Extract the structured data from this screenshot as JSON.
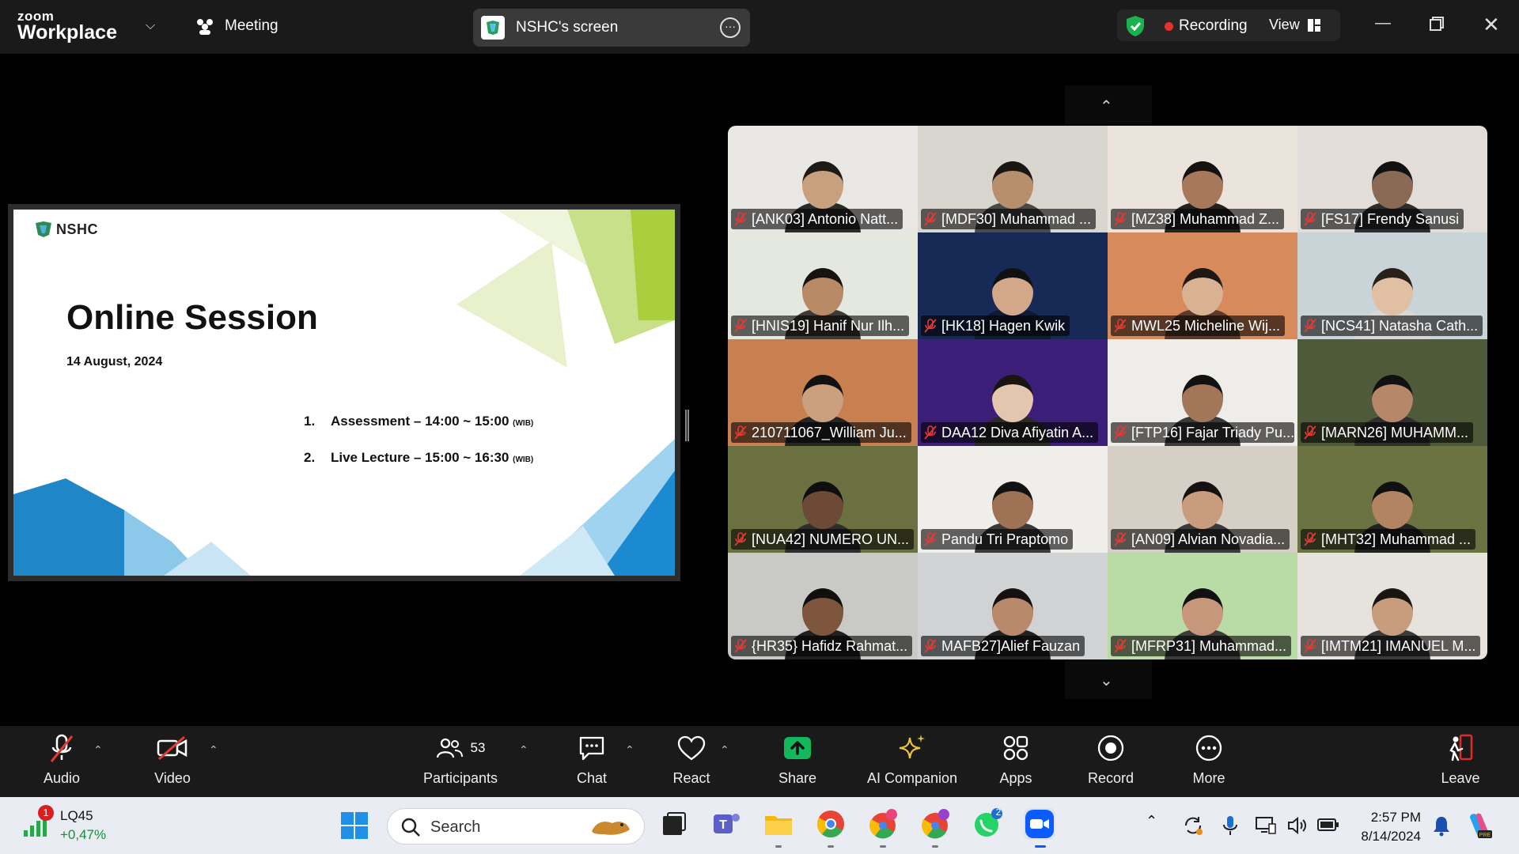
{
  "app": {
    "brand_top": "zoom",
    "brand_bottom": "Workplace"
  },
  "topbar": {
    "meeting_label": "Meeting",
    "share_title": "NSHC's screen",
    "recording_label": "Recording",
    "view_label": "View"
  },
  "slide": {
    "logo_text": "NSHC",
    "title": "Online Session",
    "date": "14 August, 2024",
    "agenda": [
      {
        "num": "1.",
        "text": "Assessment – 14:00 ~ 15:00",
        "suffix": "(WIB)"
      },
      {
        "num": "2.",
        "text": "Live Lecture – 15:00 ~ 16:30",
        "suffix": "(WIB)"
      }
    ]
  },
  "participants": [
    {
      "name": "[ANK03] Antonio Natt...",
      "bg": "#e9e7e3",
      "skin": "#c9a07e",
      "shirt": "#2b2b2b",
      "hair": "#1e1a17"
    },
    {
      "name": "[MDF30] Muhammad ...",
      "bg": "#d9d6cf",
      "skin": "#b88f6c",
      "shirt": "#4a4a4a",
      "hair": "#1a1613"
    },
    {
      "name": "[MZ38] Muhammad Z...",
      "bg": "#eae4dc",
      "skin": "#a8785a",
      "shirt": "#222222",
      "hair": "#141110"
    },
    {
      "name": "[FS17] Frendy Sanusi",
      "bg": "#e2ddd8",
      "skin": "#8a6a55",
      "shirt": "#2d2d2d",
      "hair": "#111111"
    },
    {
      "name": "[HNIS19] Hanif Nur Ilh...",
      "bg": "#e5e8df",
      "skin": "#b88a66",
      "shirt": "#3e3a36",
      "hair": "#161311"
    },
    {
      "name": "[HK18] Hagen Kwik",
      "bg": "#162a55",
      "skin": "#d3a88a",
      "shirt": "#0f1a33",
      "hair": "#111111"
    },
    {
      "name": "MWL25 Micheline Wij...",
      "bg": "#d78a5c",
      "skin": "#d8b292",
      "shirt": "#5a3b2a",
      "hair": "#1f1813"
    },
    {
      "name": "[NCS41] Natasha Cath...",
      "bg": "#c9d4d9",
      "skin": "#e0bfa3",
      "shirt": "#d8d8d8",
      "hair": "#2a201a"
    },
    {
      "name": "210711067_William Ju...",
      "bg": "#c98050",
      "skin": "#caa07f",
      "shirt": "#252525",
      "hair": "#111111"
    },
    {
      "name": "DAA12 Diva Afiyatin A...",
      "bg": "#3b1f78",
      "skin": "#e4c6ae",
      "shirt": "#2a2a2a",
      "hair": "#1a1410"
    },
    {
      "name": "[FTP16] Fajar Triady Pu...",
      "bg": "#efedea",
      "skin": "#a27658",
      "shirt": "#3a3a3a",
      "hair": "#111111"
    },
    {
      "name": "[MARN26] MUHAMM...",
      "bg": "#4f5a3a",
      "skin": "#b7876a",
      "shirt": "#2f2f2f",
      "hair": "#111111"
    },
    {
      "name": "[NUA42] NUMERO UN...",
      "bg": "#6b7040",
      "skin": "#6d4a35",
      "shirt": "#2e2e2e",
      "hair": "#0f0f0f"
    },
    {
      "name": "Pandu Tri Praptomo",
      "bg": "#f0eeea",
      "skin": "#9e7255",
      "shirt": "#3a3a3a",
      "hair": "#111111"
    },
    {
      "name": "[AN09] Alvian Novadia...",
      "bg": "#d6cfc6",
      "skin": "#c89c7c",
      "shirt": "#3a3a3a",
      "hair": "#141110"
    },
    {
      "name": "[MHT32] Muhammad ...",
      "bg": "#6c7343",
      "skin": "#b28462",
      "shirt": "#222222",
      "hair": "#111111"
    },
    {
      "name": "{HR35} Hafidz Rahmat...",
      "bg": "#c9cac5",
      "skin": "#7d563d",
      "shirt": "#1f1f1f",
      "hair": "#0f0f0f"
    },
    {
      "name": "MAFB27]Alief Fauzan",
      "bg": "#d0d2d4",
      "skin": "#b8896a",
      "shirt": "#222222",
      "hair": "#141110"
    },
    {
      "name": "[MFRP31] Muhammad...",
      "bg": "#b9dca6",
      "skin": "#c6977a",
      "shirt": "#3b3b3b",
      "hair": "#111111"
    },
    {
      "name": "[IMTM21] IMANUEL M...",
      "bg": "#e6e3dc",
      "skin": "#c79d7e",
      "shirt": "#3a3a3a",
      "hair": "#1a1511"
    }
  ],
  "toolbar": {
    "audio": "Audio",
    "video": "Video",
    "participants": "Participants",
    "participants_count": "53",
    "chat": "Chat",
    "react": "React",
    "share": "Share",
    "ai_companion": "AI Companion",
    "apps": "Apps",
    "record": "Record",
    "more": "More",
    "leave": "Leave"
  },
  "taskbar": {
    "stock_name": "LQ45",
    "stock_change": "+0,47%",
    "widget_badge": "1",
    "search_placeholder": "Search",
    "whatsapp_badge": "2",
    "time": "2:57 PM",
    "date": "8/14/2024"
  },
  "colors": {
    "accent_green": "#18b34f",
    "recording_red": "#e5322d",
    "share_green": "#12b85a",
    "leave_red": "#e02a2a"
  }
}
